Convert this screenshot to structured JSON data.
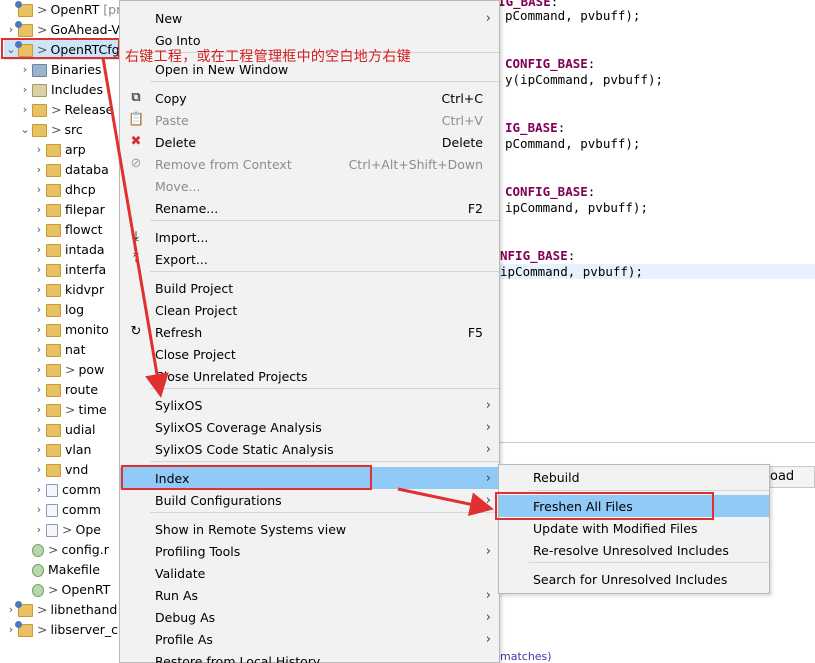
{
  "explorer": {
    "rows": [
      {
        "label": "OpenRT",
        "suffix": "[proc",
        "icon": "project",
        "twisty": "",
        "gt": ">",
        "indent": 0
      },
      {
        "label": "GoAhead-V",
        "suffix": "",
        "icon": "project",
        "twisty": "›",
        "gt": ">",
        "indent": 1
      },
      {
        "label": "OpenRTCfg",
        "suffix": "",
        "icon": "project",
        "twisty": "⌄",
        "gt": ">",
        "indent": 1
      },
      {
        "label": "Binaries",
        "suffix": "",
        "icon": "bin",
        "twisty": "›",
        "gt": "",
        "indent": 2
      },
      {
        "label": "Includes",
        "suffix": "",
        "icon": "inc",
        "twisty": "›",
        "gt": "",
        "indent": 2
      },
      {
        "label": "Release",
        "suffix": "",
        "icon": "folder",
        "twisty": "›",
        "gt": ">",
        "indent": 2
      },
      {
        "label": "src",
        "suffix": "",
        "icon": "folder",
        "twisty": "⌄",
        "gt": ">",
        "indent": 2
      },
      {
        "label": "arp",
        "suffix": "",
        "icon": "folder",
        "twisty": "›",
        "gt": "",
        "indent": 3
      },
      {
        "label": "databa",
        "suffix": "",
        "icon": "folder",
        "twisty": "›",
        "gt": "",
        "indent": 3
      },
      {
        "label": "dhcp",
        "suffix": "",
        "icon": "folder",
        "twisty": "›",
        "gt": "",
        "indent": 3
      },
      {
        "label": "filepar",
        "suffix": "",
        "icon": "folder",
        "twisty": "›",
        "gt": "",
        "indent": 3
      },
      {
        "label": "flowct",
        "suffix": "",
        "icon": "folder",
        "twisty": "›",
        "gt": "",
        "indent": 3
      },
      {
        "label": "intada",
        "suffix": "",
        "icon": "folder",
        "twisty": "›",
        "gt": "",
        "indent": 3
      },
      {
        "label": "interfa",
        "suffix": "",
        "icon": "folder",
        "twisty": "›",
        "gt": "",
        "indent": 3
      },
      {
        "label": "kidvpr",
        "suffix": "",
        "icon": "folder",
        "twisty": "›",
        "gt": "",
        "indent": 3
      },
      {
        "label": "log",
        "suffix": "",
        "icon": "folder",
        "twisty": "›",
        "gt": "",
        "indent": 3
      },
      {
        "label": "monito",
        "suffix": "",
        "icon": "folder",
        "twisty": "›",
        "gt": "",
        "indent": 3
      },
      {
        "label": "nat",
        "suffix": "",
        "icon": "folder",
        "twisty": "›",
        "gt": "",
        "indent": 3
      },
      {
        "label": "pow",
        "suffix": "",
        "icon": "folder",
        "twisty": "›",
        "gt": ">",
        "indent": 3
      },
      {
        "label": "route",
        "suffix": "",
        "icon": "folder",
        "twisty": "›",
        "gt": "",
        "indent": 3
      },
      {
        "label": "time",
        "suffix": "",
        "icon": "folder",
        "twisty": "›",
        "gt": ">",
        "indent": 3
      },
      {
        "label": "udial",
        "suffix": "",
        "icon": "folder",
        "twisty": "›",
        "gt": "",
        "indent": 3
      },
      {
        "label": "vlan",
        "suffix": "",
        "icon": "folder",
        "twisty": "›",
        "gt": "",
        "indent": 3
      },
      {
        "label": "vnd",
        "suffix": "",
        "icon": "folder",
        "twisty": "›",
        "gt": "",
        "indent": 3
      },
      {
        "label": "comm",
        "suffix": "",
        "icon": "file",
        "twisty": "›",
        "gt": "",
        "indent": 3
      },
      {
        "label": "comm",
        "suffix": "",
        "icon": "file",
        "twisty": "›",
        "gt": "",
        "indent": 3
      },
      {
        "label": "Ope",
        "suffix": "",
        "icon": "file",
        "twisty": "›",
        "gt": ">",
        "indent": 3
      },
      {
        "label": "config.r",
        "suffix": "",
        "icon": "cfg",
        "twisty": "",
        "gt": ">",
        "indent": 2
      },
      {
        "label": "Makefile",
        "suffix": "",
        "icon": "cfg",
        "twisty": "",
        "gt": "",
        "indent": 2
      },
      {
        "label": "OpenRT",
        "suffix": "",
        "icon": "cfg",
        "twisty": "",
        "gt": ">",
        "indent": 2
      },
      {
        "label": "libnethand",
        "suffix": "",
        "icon": "project",
        "twisty": "›",
        "gt": ">",
        "indent": 0
      },
      {
        "label": "libserver_c",
        "suffix": "",
        "icon": "project",
        "twisty": "›",
        "gt": ">",
        "indent": 0
      }
    ]
  },
  "editor": {
    "lines": [
      {
        "parts": [
          {
            "t": "CASE_OPEN_RT_CMD_CONFIG_BASE",
            "c": "kw"
          },
          {
            "t": ":",
            "c": ""
          }
        ]
      },
      {
        "parts": [
          {
            "t": "pCommand, pvbuff);",
            "c": ""
          }
        ]
      },
      {
        "parts": [
          {
            "t": "CONFIG_BASE",
            "c": "kw"
          },
          {
            "t": ":",
            "c": ""
          }
        ]
      },
      {
        "parts": [
          {
            "t": "y(ipCommand, pvbuff);",
            "c": ""
          }
        ]
      },
      {
        "parts": [
          {
            "t": "IG_BASE",
            "c": "kw"
          },
          {
            "t": ":",
            "c": ""
          }
        ]
      },
      {
        "parts": [
          {
            "t": "pCommand, pvbuff);",
            "c": ""
          }
        ]
      },
      {
        "parts": [
          {
            "t": "CONFIG_BASE",
            "c": "kw"
          },
          {
            "t": ":",
            "c": ""
          }
        ]
      },
      {
        "parts": [
          {
            "t": "ipCommand, pvbuff);",
            "c": ""
          }
        ]
      },
      {
        "parts": [
          {
            "t": "NFIG_BASE",
            "c": "kw"
          },
          {
            "t": ":",
            "c": ""
          }
        ]
      },
      {
        "parts": [
          {
            "t": "ipCommand, pvbuff);",
            "c": ""
          }
        ]
      }
    ],
    "console_tab": "oad",
    "console_tail": "matches)"
  },
  "context_menu": {
    "items": [
      {
        "label": "New",
        "key": "",
        "arrow": true,
        "disabled": false,
        "icon": ""
      },
      {
        "label": "Go Into",
        "key": "",
        "arrow": false,
        "disabled": false,
        "icon": ""
      },
      {
        "label": "Open in New Window",
        "key": "",
        "arrow": false,
        "disabled": false,
        "icon": ""
      },
      {
        "label": "Copy",
        "key": "Ctrl+C",
        "arrow": false,
        "disabled": false,
        "icon": "copy-icon"
      },
      {
        "label": "Paste",
        "key": "Ctrl+V",
        "arrow": false,
        "disabled": true,
        "icon": "paste-icon"
      },
      {
        "label": "Delete",
        "key": "Delete",
        "arrow": false,
        "disabled": false,
        "icon": "delete-icon"
      },
      {
        "label": "Remove from Context",
        "key": "Ctrl+Alt+Shift+Down",
        "arrow": false,
        "disabled": true,
        "icon": "remove-context-icon"
      },
      {
        "label": "Move...",
        "key": "",
        "arrow": false,
        "disabled": true,
        "icon": ""
      },
      {
        "label": "Rename...",
        "key": "F2",
        "arrow": false,
        "disabled": false,
        "icon": ""
      },
      {
        "label": "Import...",
        "key": "",
        "arrow": false,
        "disabled": false,
        "icon": "import-icon"
      },
      {
        "label": "Export...",
        "key": "",
        "arrow": false,
        "disabled": false,
        "icon": "export-icon"
      },
      {
        "label": "Build Project",
        "key": "",
        "arrow": false,
        "disabled": false,
        "icon": ""
      },
      {
        "label": "Clean Project",
        "key": "",
        "arrow": false,
        "disabled": false,
        "icon": ""
      },
      {
        "label": "Refresh",
        "key": "F5",
        "arrow": false,
        "disabled": false,
        "icon": "refresh-icon"
      },
      {
        "label": "Close Project",
        "key": "",
        "arrow": false,
        "disabled": false,
        "icon": ""
      },
      {
        "label": "Close Unrelated Projects",
        "key": "",
        "arrow": false,
        "disabled": false,
        "icon": ""
      },
      {
        "label": "SylixOS",
        "key": "",
        "arrow": true,
        "disabled": false,
        "icon": ""
      },
      {
        "label": "SylixOS Coverage Analysis",
        "key": "",
        "arrow": true,
        "disabled": false,
        "icon": ""
      },
      {
        "label": "SylixOS Code Static Analysis",
        "key": "",
        "arrow": true,
        "disabled": false,
        "icon": ""
      },
      {
        "label": "Index",
        "key": "",
        "arrow": true,
        "disabled": false,
        "icon": "",
        "active": true
      },
      {
        "label": "Build Configurations",
        "key": "",
        "arrow": true,
        "disabled": false,
        "icon": ""
      },
      {
        "label": "Show in Remote Systems view",
        "key": "",
        "arrow": false,
        "disabled": false,
        "icon": ""
      },
      {
        "label": "Profiling Tools",
        "key": "",
        "arrow": true,
        "disabled": false,
        "icon": ""
      },
      {
        "label": "Validate",
        "key": "",
        "arrow": false,
        "disabled": false,
        "icon": ""
      },
      {
        "label": "Run As",
        "key": "",
        "arrow": true,
        "disabled": false,
        "icon": ""
      },
      {
        "label": "Debug As",
        "key": "",
        "arrow": true,
        "disabled": false,
        "icon": ""
      },
      {
        "label": "Profile As",
        "key": "",
        "arrow": true,
        "disabled": false,
        "icon": ""
      },
      {
        "label": "Restore from Local History...",
        "key": "",
        "arrow": false,
        "disabled": false,
        "icon": ""
      }
    ]
  },
  "index_submenu": {
    "items": [
      {
        "label": "Rebuild",
        "active": false
      },
      {
        "label": "Freshen All Files",
        "active": true
      },
      {
        "label": "Update with Modified Files",
        "active": false
      },
      {
        "label": "Re-resolve Unresolved Includes",
        "active": false
      },
      {
        "label": "Search for Unresolved Includes",
        "active": false
      }
    ]
  },
  "annotation": {
    "text": "右键工程，或在工程管理框中的空白地方右键",
    "color": "#d02020"
  },
  "colors": {
    "highlight": "#91c9f7",
    "annotation_red": "#e03030",
    "menu_bg": "#f2f2f2",
    "keyword": "#7f0055"
  }
}
